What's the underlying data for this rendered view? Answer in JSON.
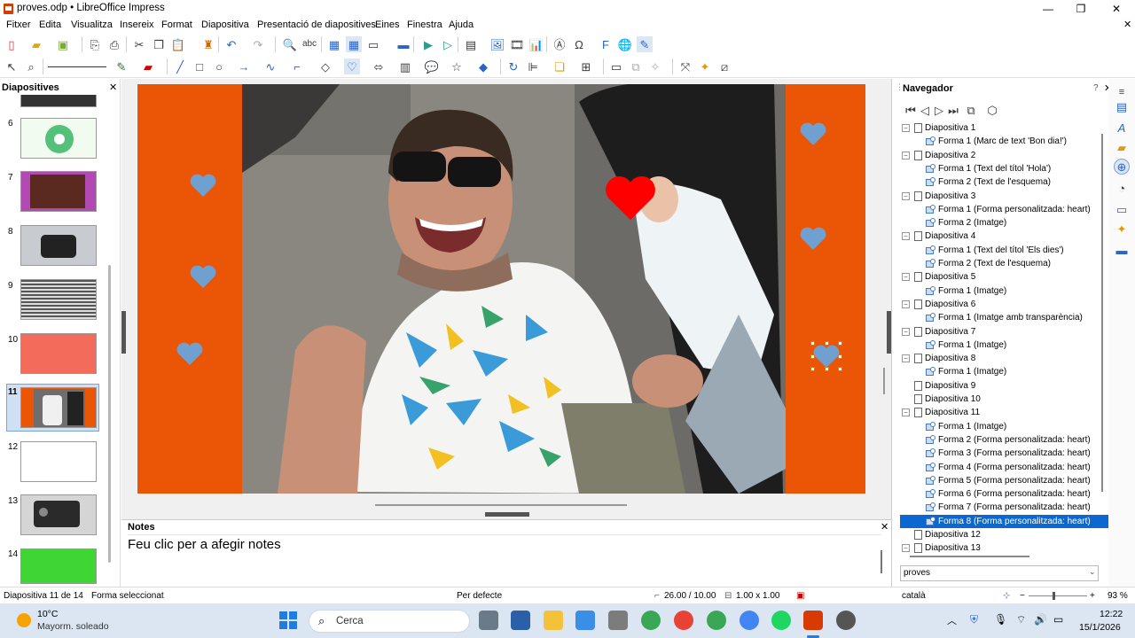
{
  "window": {
    "title": "proves.odp • LibreOffice Impress",
    "minimize": "—",
    "maximize": "❐",
    "close": "✕"
  },
  "menu": [
    "Fitxer",
    "Edita",
    "Visualitza",
    "Insereix",
    "Format",
    "Diapositiva",
    "Presentació de diapositives",
    "Eines",
    "Finestra",
    "Ajuda"
  ],
  "slides_panel": {
    "title": "Diapositives",
    "thumbs": [
      {
        "num": "6",
        "bg": "#e8f5e9"
      },
      {
        "num": "7",
        "bg": "#8a2a8a"
      },
      {
        "num": "8",
        "bg": "#9aa0a6"
      },
      {
        "num": "9",
        "bg": "#888888"
      },
      {
        "num": "10",
        "bg": "#f26b5b"
      },
      {
        "num": "11",
        "bg": "#ea5506"
      },
      {
        "num": "12",
        "bg": "#ffffff"
      },
      {
        "num": "13",
        "bg": "#cfcfcf"
      },
      {
        "num": "14",
        "bg": "#3fd534"
      }
    ]
  },
  "notes": {
    "title": "Notes",
    "placeholder": "Feu clic per a afegir notes"
  },
  "navigator": {
    "title": "Navegador",
    "items": [
      {
        "label": "Diapositiva 1",
        "level": 0,
        "expanded": true
      },
      {
        "label": "Forma 1 (Marc de text 'Bon dia!')",
        "level": 1
      },
      {
        "label": "Diapositiva 2",
        "level": 0,
        "expanded": true
      },
      {
        "label": "Forma 1 (Text del títol 'Hola')",
        "level": 1
      },
      {
        "label": "Forma 2 (Text de l'esquema)",
        "level": 1
      },
      {
        "label": "Diapositiva 3",
        "level": 0,
        "expanded": true
      },
      {
        "label": "Forma 1 (Forma personalitzada: heart)",
        "level": 1
      },
      {
        "label": "Forma 2 (Imatge)",
        "level": 1
      },
      {
        "label": "Diapositiva 4",
        "level": 0,
        "expanded": true
      },
      {
        "label": "Forma 1 (Text del títol 'Els dies')",
        "level": 1
      },
      {
        "label": "Forma 2 (Text de l'esquema)",
        "level": 1
      },
      {
        "label": "Diapositiva 5",
        "level": 0,
        "expanded": true
      },
      {
        "label": "Forma 1 (Imatge)",
        "level": 1
      },
      {
        "label": "Diapositiva 6",
        "level": 0,
        "expanded": true
      },
      {
        "label": "Forma 1 (Imatge amb transparència)",
        "level": 1
      },
      {
        "label": "Diapositiva 7",
        "level": 0,
        "expanded": true
      },
      {
        "label": "Forma 1 (Imatge)",
        "level": 1
      },
      {
        "label": "Diapositiva 8",
        "level": 0,
        "expanded": true
      },
      {
        "label": "Forma 1 (Imatge)",
        "level": 1
      },
      {
        "label": "Diapositiva 9",
        "level": 0
      },
      {
        "label": "Diapositiva 10",
        "level": 0
      },
      {
        "label": "Diapositiva 11",
        "level": 0,
        "expanded": true
      },
      {
        "label": "Forma 1 (Imatge)",
        "level": 1
      },
      {
        "label": "Forma 2 (Forma personalitzada: heart)",
        "level": 1
      },
      {
        "label": "Forma 3 (Forma personalitzada: heart)",
        "level": 1
      },
      {
        "label": "Forma 4 (Forma personalitzada: heart)",
        "level": 1
      },
      {
        "label": "Forma 5 (Forma personalitzada: heart)",
        "level": 1
      },
      {
        "label": "Forma 6 (Forma personalitzada: heart)",
        "level": 1
      },
      {
        "label": "Forma 7 (Forma personalitzada: heart)",
        "level": 1
      },
      {
        "label": "Forma 8 (Forma personalitzada: heart)",
        "level": 1,
        "selected": true
      },
      {
        "label": "Diapositiva 12",
        "level": 0
      },
      {
        "label": "Diapositiva 13",
        "level": 0,
        "expanded": true
      }
    ],
    "document": "proves"
  },
  "statusbar": {
    "slide": "Diapositiva 11 de 14",
    "selection": "Forma seleccionat",
    "layout": "Per defecte",
    "position": "26.00 / 10.00",
    "size": "1.00 x 1.00",
    "language": "català",
    "zoom": "93 %"
  },
  "taskbar": {
    "weather_temp": "10°C",
    "weather_desc": "Mayorm. soleado",
    "search": "Cerca",
    "time": "12:22",
    "date": "15/1/2026"
  },
  "colors": {
    "slide_orange": "#ea5506",
    "heart_blue": "#6fa0d0",
    "heart_red": "#ff0000",
    "selection": "#0b68d0"
  }
}
